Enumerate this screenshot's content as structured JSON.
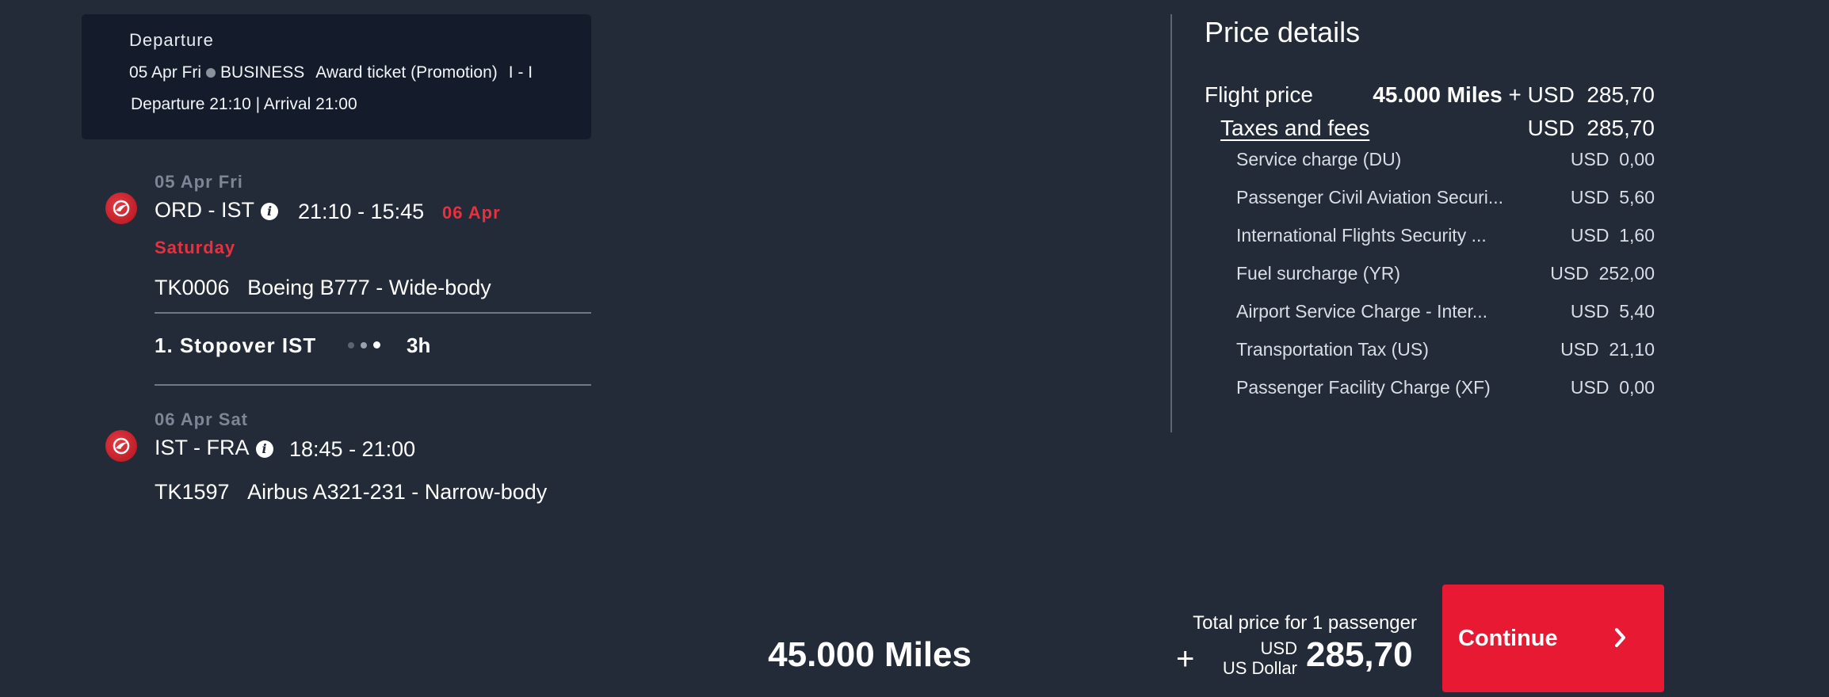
{
  "departure": {
    "title": "Departure",
    "date": "05 Apr Fri",
    "cabin": "BUSINESS",
    "fare_type": "Award ticket (Promotion)",
    "booking_class": "I - I",
    "times": "Departure 21:10 | Arrival 21:00"
  },
  "segments": [
    {
      "date": "05 Apr Fri",
      "route": "ORD - IST",
      "times": "21:10 - 15:45",
      "next_day": "06 Apr",
      "next_day_weekday": "Saturday",
      "flight_number": "TK0006",
      "aircraft": "Boeing B777 - Wide-body"
    },
    {
      "date": "06 Apr Sat",
      "route": "IST - FRA",
      "times": "18:45 - 21:00",
      "flight_number": "TK1597",
      "aircraft": "Airbus A321-231 - Narrow-body"
    }
  ],
  "stopover": {
    "label": "1. Stopover IST",
    "duration": "3h"
  },
  "price_details": {
    "title": "Price details",
    "flight_price_label": "Flight price",
    "flight_price_miles": "45.000 Miles",
    "flight_price_plus": "+",
    "flight_price_usd": "USD  285,70",
    "taxes_label": "Taxes and fees",
    "taxes_amount": "USD  285,70",
    "fees": [
      {
        "label": "Service charge (DU)",
        "amount": "USD  0,00"
      },
      {
        "label": "Passenger Civil Aviation Securi...",
        "amount": "USD  5,60"
      },
      {
        "label": "International Flights Security ...",
        "amount": "USD  1,60"
      },
      {
        "label": "Fuel surcharge (YR)",
        "amount": "USD  252,00"
      },
      {
        "label": "Airport Service Charge - Inter...",
        "amount": "USD  5,40"
      },
      {
        "label": "Transportation Tax (US)",
        "amount": "USD  21,10"
      },
      {
        "label": "Passenger Facility Charge (XF)",
        "amount": "USD  0,00"
      }
    ]
  },
  "total": {
    "caption": "Total price for 1 passenger",
    "miles": "45.000 Miles",
    "plus": "+",
    "currency_code": "USD",
    "currency_name": "US Dollar",
    "amount": "285,70"
  },
  "continue_label": "Continue",
  "colors": {
    "background": "#232a38",
    "card": "#141b2b",
    "accent_red": "#e81932",
    "muted": "#7d8696"
  },
  "icons": {
    "airline_logo": "airline-logo-icon",
    "info": "info-icon",
    "chevron": "chevron-right-icon"
  }
}
